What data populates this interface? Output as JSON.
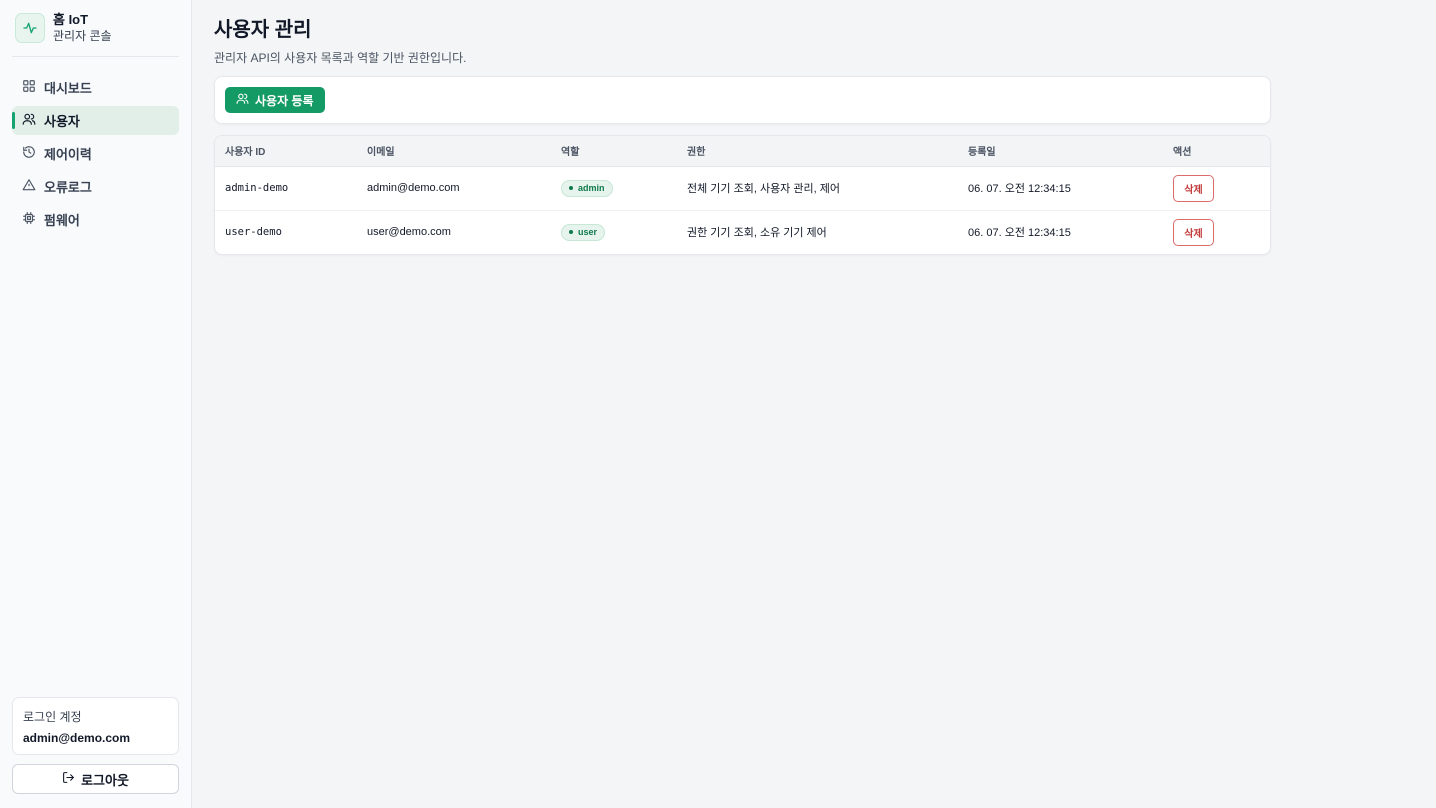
{
  "brand": {
    "title": "홈 IoT",
    "subtitle": "관리자 콘솔"
  },
  "nav": [
    {
      "label": "대시보드",
      "icon": "grid-icon"
    },
    {
      "label": "사용자",
      "icon": "users-icon",
      "active": true
    },
    {
      "label": "제어이력",
      "icon": "history-icon"
    },
    {
      "label": "오류로그",
      "icon": "warning-icon"
    },
    {
      "label": "펌웨어",
      "icon": "chip-icon"
    }
  ],
  "account": {
    "label": "로그인 계정",
    "email": "admin@demo.com"
  },
  "logout": {
    "label": "로그아웃"
  },
  "page": {
    "title": "사용자 관리",
    "description": "관리자 API의 사용자 목록과 역할 기반 권한입니다."
  },
  "toolbar": {
    "register_label": "사용자 등록"
  },
  "table": {
    "headers": [
      "사용자 ID",
      "이메일",
      "역할",
      "권한",
      "등록일",
      "액션"
    ],
    "rows": [
      {
        "id": "admin-demo",
        "email": "admin@demo.com",
        "role": "admin",
        "permissions": "전체 기기 조회, 사용자 관리, 제어",
        "created": "06. 07. 오전 12:34:15",
        "action": "삭제"
      },
      {
        "id": "user-demo",
        "email": "user@demo.com",
        "role": "user",
        "permissions": "권한 기기 조회, 소유 기기 제어",
        "created": "06. 07. 오전 12:34:15",
        "action": "삭제"
      }
    ]
  },
  "colors": {
    "accent": "#149a64",
    "danger": "#c23b3b",
    "badge_bg": "#e6f4ed"
  }
}
